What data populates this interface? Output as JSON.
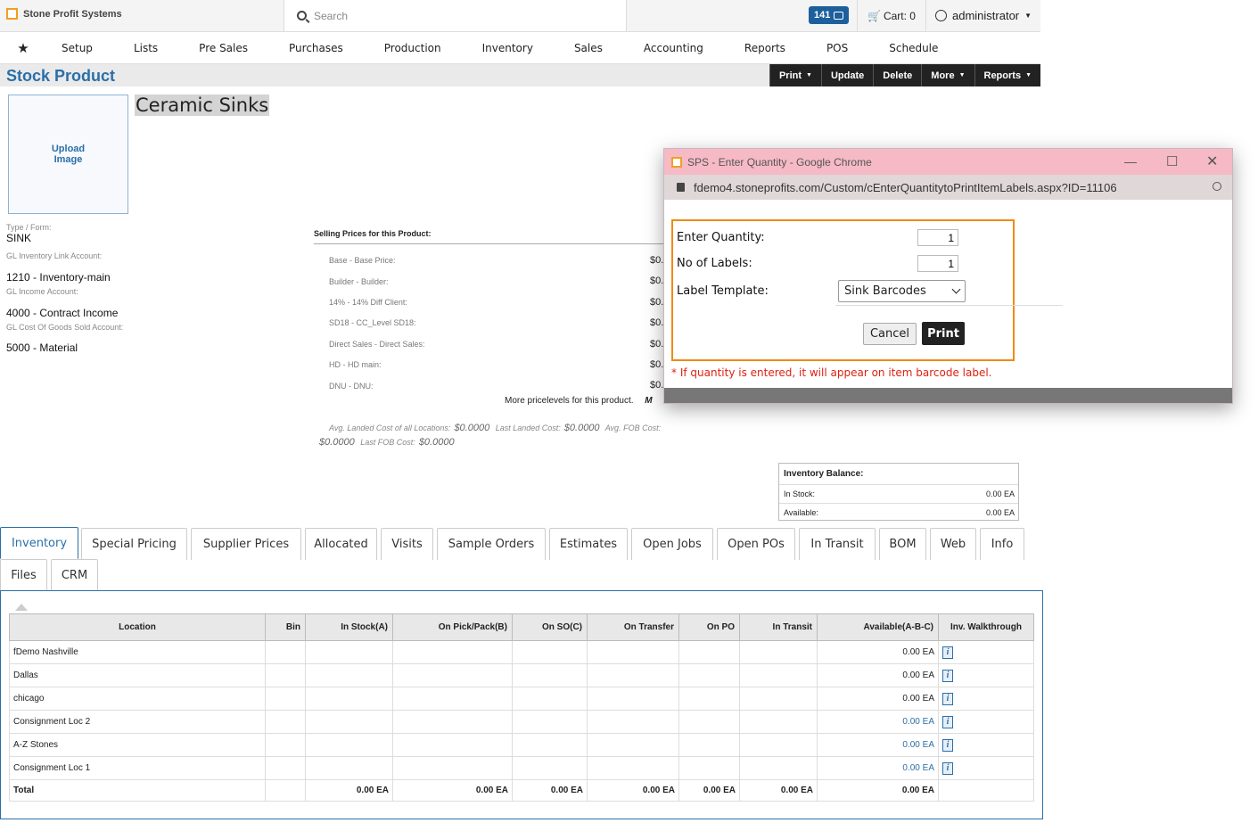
{
  "app": {
    "brand": "Stone Profit Systems"
  },
  "top": {
    "search_placeholder": "Search",
    "badge_count": "141",
    "cart": "Cart: 0",
    "user": "administrator"
  },
  "nav": [
    "Setup",
    "Lists",
    "Pre Sales",
    "Purchases",
    "Production",
    "Inventory",
    "Sales",
    "Accounting",
    "Reports",
    "POS",
    "Schedule"
  ],
  "page": {
    "title": "Stock Product"
  },
  "actions": [
    "Print",
    "Update",
    "Delete",
    "More",
    "Reports"
  ],
  "product": {
    "upload_label": "Upload\nImage",
    "name": "Ceramic Sinks",
    "type_label": "Type / Form:",
    "type_value": "SINK",
    "gl_inv_label": "GL Inventory Link Account:",
    "gl_inv_value": "1210 - Inventory-main",
    "gl_income_label": "GL Income Account:",
    "gl_income_value": "4000 - Contract Income",
    "gl_cogs_label": "GL Cost Of Goods Sold Account:",
    "gl_cogs_value": "5000 - Material"
  },
  "prices": {
    "heading": "Selling Prices for this Product:",
    "rows": [
      {
        "label": "Base - Base Price:",
        "value": "$0."
      },
      {
        "label": "Builder - Builder:",
        "value": "$0."
      },
      {
        "label": "14% - 14% Diff Client:",
        "value": "$0."
      },
      {
        "label": "SD18 - CC_Level SD18:",
        "value": "$0."
      },
      {
        "label": "Direct Sales - Direct Sales:",
        "value": "$0."
      },
      {
        "label": "HD - HD main:",
        "value": "$0."
      },
      {
        "label": "DNU - DNU:",
        "value": "$0."
      }
    ],
    "more": "More pricelevels for this product.",
    "more_cut": "M",
    "avg_landed_label": "Avg. Landed Cost of all Locations:",
    "avg_landed": "$0.0000",
    "last_landed_label": "Last Landed Cost:",
    "last_landed": "$0.0000",
    "avg_fob_label": "Avg. FOB Cost:",
    "avg_fob": "$0.0000",
    "last_fob_label": "Last FOB Cost:",
    "last_fob": "$0.0000"
  },
  "inventory_balance": {
    "title": "Inventory Balance:",
    "in_stock_label": "In Stock:",
    "in_stock": "0.00 EA",
    "available_label": "Available:",
    "available": "0.00 EA"
  },
  "tabs": [
    "Inventory",
    "Special Pricing",
    "Supplier Prices",
    "Allocated",
    "Visits",
    "Sample Orders",
    "Estimates",
    "Open Jobs",
    "Open POs",
    "In Transit",
    "BOM",
    "Web",
    "Info",
    "Files",
    "CRM"
  ],
  "table": {
    "headers": [
      "Location",
      "Bin",
      "In Stock(A)",
      "On Pick/Pack(B)",
      "On SO(C)",
      "On Transfer",
      "On PO",
      "In Transit",
      "Available(A-B-C)",
      "Inv. Walkthrough"
    ],
    "rows": [
      {
        "location": "fDemo Nashville",
        "available": "0.00 EA",
        "link": false
      },
      {
        "location": "Dallas",
        "available": "0.00 EA",
        "link": false
      },
      {
        "location": "chicago",
        "available": "0.00 EA",
        "link": false
      },
      {
        "location": "Consignment Loc 2",
        "available": "0.00 EA",
        "link": true
      },
      {
        "location": "A-Z Stones",
        "available": "0.00 EA",
        "link": true
      },
      {
        "location": "Consignment Loc 1",
        "available": "0.00 EA",
        "link": true
      }
    ],
    "total": {
      "label": "Total",
      "in_stock": "0.00 EA",
      "pick": "0.00 EA",
      "so": "0.00 EA",
      "transfer": "0.00 EA",
      "po": "0.00 EA",
      "transit": "0.00 EA",
      "available": "0.00 EA"
    }
  },
  "popup": {
    "title": "SPS - Enter Quantity - Google Chrome",
    "url": "fdemo4.stoneprofits.com/Custom/cEnterQuantitytoPrintItemLabels.aspx?ID=11106",
    "qty_label": "Enter Quantity:",
    "qty_value": "1",
    "labels_label": "No of Labels:",
    "labels_value": "1",
    "template_label": "Label Template:",
    "template_value": "Sink Barcodes",
    "cancel": "Cancel",
    "print": "Print",
    "note": "* If quantity is entered, it will appear on item barcode label."
  }
}
